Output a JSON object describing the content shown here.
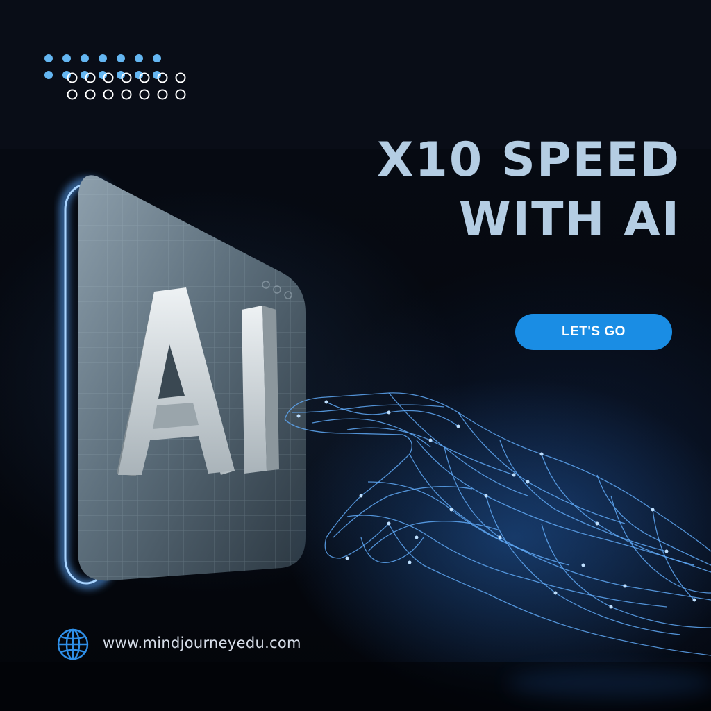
{
  "headline": {
    "line1": "X10 SPEED",
    "line2": "WITH AI"
  },
  "panel": {
    "letters": "AI"
  },
  "cta": {
    "label": "LET'S GO"
  },
  "footer": {
    "website": "www.mindjourneyedu.com",
    "icon": "globe-icon"
  },
  "colors": {
    "headline": "#b4cde3",
    "button": "#1a8de4",
    "accent_glow": "#4fa3ff",
    "dots": "#64b6f2"
  },
  "icons": {
    "dot_pattern": "dot-grid-icon",
    "hand": "wireframe-hand"
  }
}
